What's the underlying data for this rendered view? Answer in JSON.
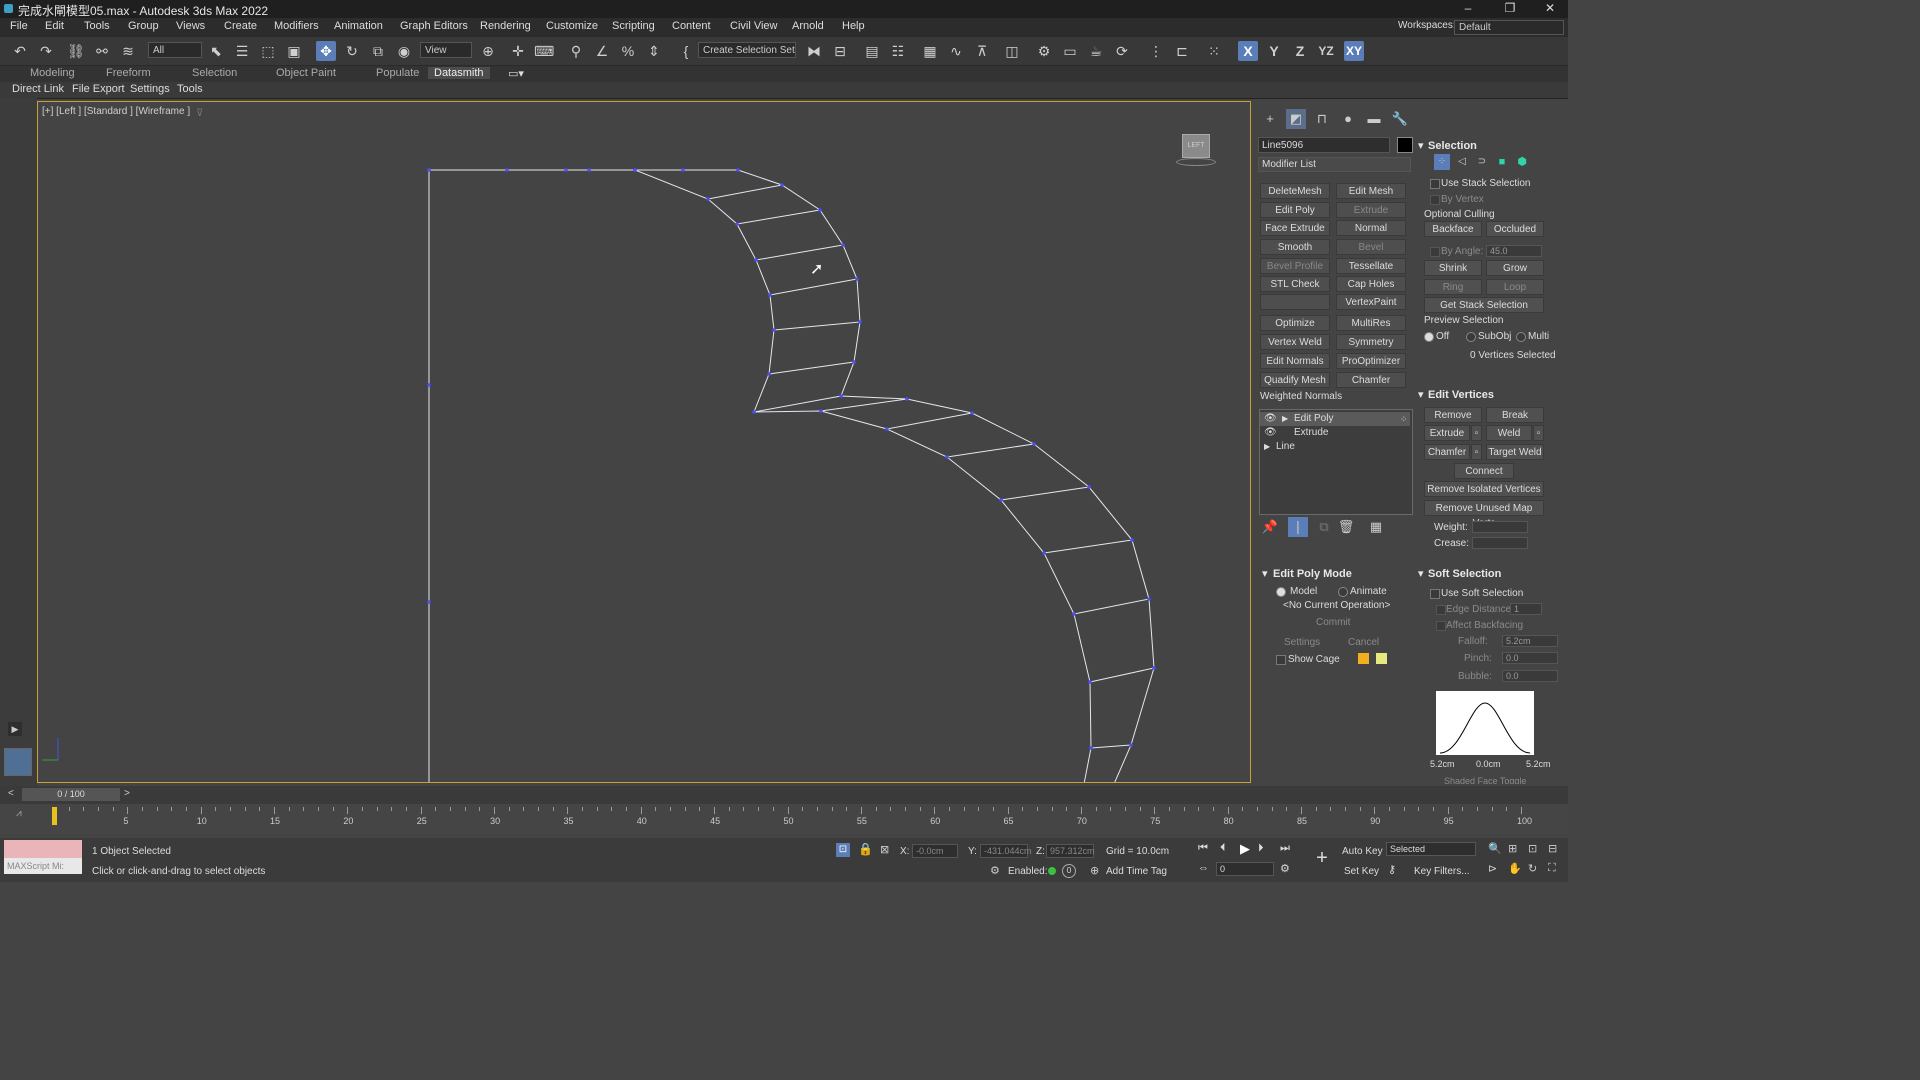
{
  "window": {
    "title": "完成水閘模型05.max - Autodesk 3ds Max 2022",
    "minimize": "–",
    "restore": "❐",
    "close": "✕"
  },
  "menu": [
    "File",
    "Edit",
    "Tools",
    "Group",
    "Views",
    "Create",
    "Modifiers",
    "Animation",
    "Graph Editors",
    "Rendering",
    "Customize",
    "Scripting",
    "Content",
    "Civil View",
    "Arnold",
    "Help"
  ],
  "workspaces": {
    "label": "Workspaces:",
    "value": "Default"
  },
  "toolbar": {
    "filter": "All",
    "ref_coord": "View",
    "selection_set": "Create Selection Set",
    "axis_x": "X",
    "axis_y": "Y",
    "axis_z": "Z",
    "axis_yz": "YZ",
    "axis_xy": "XY"
  },
  "ribbon_tabs": [
    "Modeling",
    "Freeform",
    "Selection",
    "Object Paint",
    "Populate",
    "Datasmith"
  ],
  "ribbon_tools": [
    "Direct Link",
    "File Export",
    "Settings",
    "Tools"
  ],
  "viewport": {
    "label": "[+] [Left ] [Standard ] [Wireframe ]",
    "viewcube": "LEFT"
  },
  "object_name": "Line5096",
  "modifier_list": "Modifier List",
  "modifier_buttons": [
    [
      "DeleteMesh",
      "Edit Mesh"
    ],
    [
      "Edit Poly",
      "Extrude"
    ],
    [
      "Face Extrude",
      "Normal"
    ],
    [
      "Smooth",
      "Bevel"
    ],
    [
      "Bevel Profile",
      "Tessellate"
    ],
    [
      "STL Check",
      "Cap Holes"
    ],
    [
      "",
      "VertexPaint"
    ],
    [
      "Optimize",
      "MultiRes"
    ],
    [
      "Vertex Weld",
      "Symmetry"
    ],
    [
      "Edit Normals",
      "ProOptimizer"
    ],
    [
      "Quadify Mesh",
      "Chamfer"
    ]
  ],
  "weighted_normals": "Weighted Normals",
  "stack": [
    "Edit Poly",
    "Extrude",
    "Line"
  ],
  "edit_poly_mode": {
    "title": "Edit Poly Mode",
    "model": "Model",
    "animate": "Animate",
    "current_op": "<No Current Operation>",
    "commit": "Commit",
    "settings": "Settings",
    "cancel": "Cancel",
    "show_cage": "Show Cage"
  },
  "selection": {
    "title": "Selection",
    "use_stack": "Use Stack Selection",
    "by_vertex": "By Vertex",
    "optional_culling": "Optional Culling",
    "backface": "Backface",
    "occluded": "Occluded",
    "by_angle": "By Angle:",
    "by_angle_value": "45.0",
    "shrink": "Shrink",
    "grow": "Grow",
    "ring": "Ring",
    "loop": "Loop",
    "get_stack": "Get Stack Selection",
    "preview": "Preview Selection",
    "off": "Off",
    "subobj": "SubObj",
    "multi": "Multi",
    "status": "0 Vertices Selected"
  },
  "edit_vertices": {
    "title": "Edit Vertices",
    "remove": "Remove",
    "break": "Break",
    "extrude": "Extrude",
    "weld": "Weld",
    "chamfer": "Chamfer",
    "target_weld": "Target Weld",
    "connect": "Connect",
    "remove_isolated": "Remove Isolated Vertices",
    "remove_unused": "Remove Unused Map Verts",
    "weight": "Weight:",
    "crease": "Crease:"
  },
  "soft_selection": {
    "title": "Soft Selection",
    "use_soft": "Use Soft Selection",
    "edge_distance": "Edge Distance:",
    "edge_distance_value": "1",
    "affect_backfacing": "Affect Backfacing",
    "falloff": "Falloff:",
    "falloff_value": "5.2cm",
    "pinch": "Pinch:",
    "pinch_value": "0.0",
    "bubble": "Bubble:",
    "bubble_value": "0.0",
    "curve_labels": [
      "5.2cm",
      "0.0cm",
      "5.2cm"
    ],
    "shaded_face": "Shaded Face Toggle"
  },
  "timeline": {
    "frame": "0 / 100",
    "ticks": [
      "5",
      "10",
      "15",
      "20",
      "25",
      "30",
      "35",
      "40",
      "45",
      "50",
      "55",
      "60",
      "65",
      "70",
      "75",
      "80",
      "85",
      "90",
      "95",
      "100"
    ]
  },
  "status": {
    "maxscript": "MAXScript Mi:",
    "objects": "1 Object Selected",
    "prompt": "Click or click-and-drag to select objects",
    "x_label": "X:",
    "x_value": "-0.0cm",
    "y_label": "Y:",
    "y_value": "-431.044cm",
    "z_label": "Z:",
    "z_value": "957.312cm",
    "grid": "Grid = 10.0cm",
    "enabled": "Enabled:",
    "add_time_tag": "Add Time Tag",
    "auto_key": "Auto Key",
    "selected": "Selected",
    "set_key": "Set Key",
    "key_filters": "Key Filters...",
    "frame_value": "0"
  },
  "colors": {
    "accent": "#5b7db8",
    "viewport_border": "#c9a13b",
    "wire": "#e6e6f0",
    "vertex": "#4d4dff",
    "cage1": "#f2b01e",
    "cage2": "#e8e880"
  }
}
